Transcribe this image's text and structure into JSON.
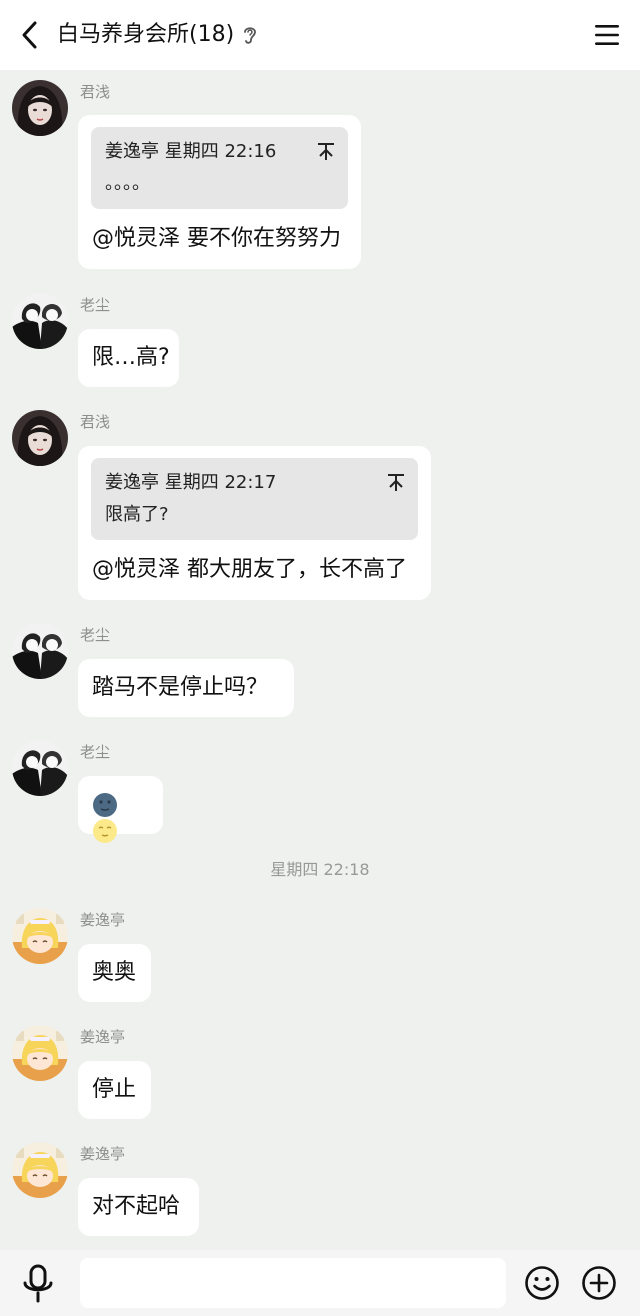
{
  "header": {
    "title": "白马养身会所(18)",
    "back_icon": "chevron-left-icon",
    "ear_icon": "ear-icon",
    "menu_icon": "hamburger-menu-icon"
  },
  "messages": [
    {
      "sender": "君浅",
      "avatar": "avatar-dark-hair-girl",
      "quote": {
        "header": "姜逸亭 星期四 22:16",
        "body": "。。。。"
      },
      "text": "@悦灵泽 要不你在努努力"
    },
    {
      "sender": "老尘",
      "avatar": "avatar-manga-couple",
      "text": "限…高?"
    },
    {
      "sender": "君浅",
      "avatar": "avatar-dark-hair-girl",
      "quote": {
        "header": "姜逸亭 星期四 22:17",
        "body": "限高了?"
      },
      "text": "@悦灵泽 都大朋友了，长不高了"
    },
    {
      "sender": "老尘",
      "avatar": "avatar-manga-couple",
      "text": "踏马不是停止吗？"
    },
    {
      "sender": "老尘",
      "avatar": "avatar-manga-couple",
      "emojis": [
        "new-moon-face-emoji",
        "full-moon-face-emoji"
      ]
    },
    {
      "sender": "姜逸亭",
      "avatar": "avatar-blonde-anime",
      "text": "奥奥"
    },
    {
      "sender": "姜逸亭",
      "avatar": "avatar-blonde-anime",
      "text": "停止"
    },
    {
      "sender": "姜逸亭",
      "avatar": "avatar-blonde-anime",
      "text": "对不起哈"
    }
  ],
  "time_separator": "星期四 22:18",
  "input_bar": {
    "mic_icon": "microphone-icon",
    "input_value": "",
    "emoji_icon": "smiley-icon",
    "plus_icon": "plus-circle-icon"
  },
  "colors": {
    "chat_background": "#eef1ee",
    "bubble": "#ffffff",
    "quote_background": "#e6e6e6",
    "secondary_text": "#8e8e8e"
  }
}
